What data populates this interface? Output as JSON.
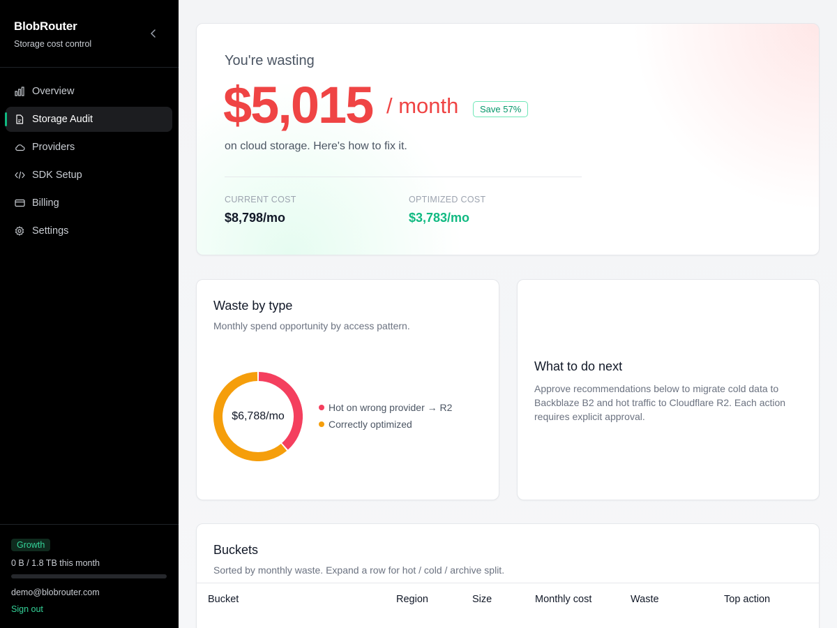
{
  "brand": {
    "name": "BlobRouter",
    "subtitle": "Storage cost control"
  },
  "nav": {
    "items": [
      {
        "label": "Overview",
        "icon": "bar-chart-icon"
      },
      {
        "label": "Storage Audit",
        "icon": "file-icon",
        "active": true
      },
      {
        "label": "Providers",
        "icon": "cloud-icon"
      },
      {
        "label": "SDK Setup",
        "icon": "code-icon"
      },
      {
        "label": "Billing",
        "icon": "credit-card-icon"
      },
      {
        "label": "Settings",
        "icon": "gear-icon"
      }
    ]
  },
  "account": {
    "plan": "Growth",
    "usage_text": "0 B / 1.8 TB this month",
    "usage_fraction": 0,
    "email": "demo@blobrouter.com",
    "sign_out": "Sign out"
  },
  "hero": {
    "pre": "You're wasting",
    "amount": "$5,015",
    "unit": "/ month",
    "save_badge": "Save 57%",
    "sub": "on cloud storage. Here's how to fix it.",
    "current_label": "CURRENT COST",
    "current_value": "$8,798/mo",
    "optimized_label": "OPTIMIZED COST",
    "optimized_value": "$3,783/mo"
  },
  "waste": {
    "title": "Waste by type",
    "subtitle": "Monthly spend opportunity by access pattern.",
    "center_label": "$6,788/mo",
    "legend": [
      {
        "label": "Hot on wrong provider → R2",
        "color": "#f43f5e"
      },
      {
        "label": "Correctly optimized",
        "color": "#f59e0b"
      }
    ]
  },
  "chart_data": {
    "type": "pie",
    "categories": [
      "Hot on wrong provider → R2",
      "Correctly optimized"
    ],
    "values": [
      2620,
      4168
    ],
    "colors": [
      "#f43f5e",
      "#f59e0b"
    ],
    "title": "Waste by type",
    "center_label": "$6,788/mo"
  },
  "next": {
    "title": "What to do next",
    "body": "Approve recommendations below to migrate cold data to Backblaze B2 and hot traffic to Cloudflare R2. Each action requires explicit approval."
  },
  "buckets": {
    "title": "Buckets",
    "subtitle": "Sorted by monthly waste. Expand a row for hot / cold / archive split.",
    "columns": [
      "Bucket",
      "Region",
      "Size",
      "Monthly cost",
      "Waste",
      "Top action"
    ]
  },
  "colors": {
    "accent": "#10b981",
    "danger": "#ef4444",
    "sidebar_bg": "#000000"
  }
}
